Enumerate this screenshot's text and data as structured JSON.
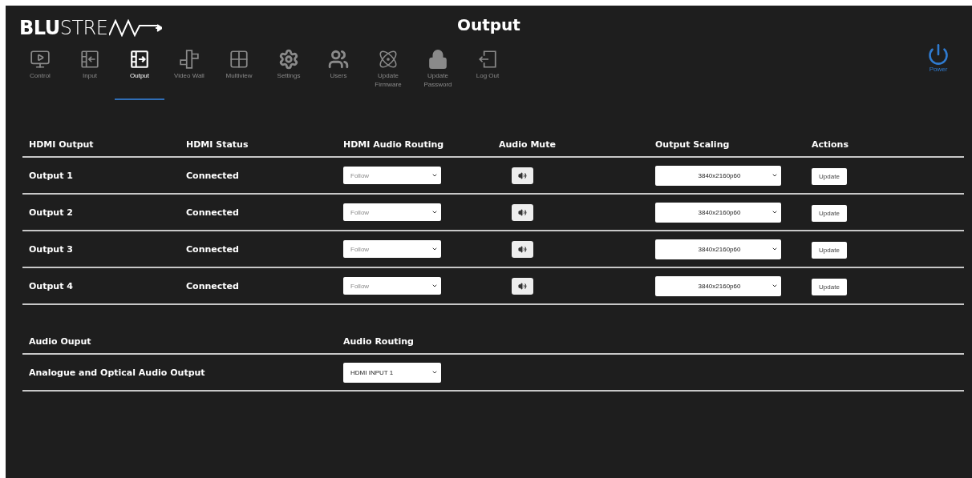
{
  "logo": {
    "text": "**BLU**STRE"
  },
  "page_title": "Output",
  "nav": [
    {
      "label": "Control",
      "kind": "control",
      "selected": false
    },
    {
      "label": "Input",
      "kind": "input",
      "selected": false
    },
    {
      "label": "Output",
      "kind": "output",
      "selected": true
    },
    {
      "label": "Video Wall",
      "kind": "videowall",
      "selected": false
    },
    {
      "label": "Multiview",
      "kind": "multiview",
      "selected": false
    },
    {
      "label": "Settings",
      "kind": "settings",
      "selected": false
    },
    {
      "label": "Users",
      "kind": "users",
      "selected": false
    },
    {
      "label": "Update Firmware",
      "kind": "firmware",
      "selected": false
    },
    {
      "label": "Update Password",
      "kind": "password",
      "selected": false
    },
    {
      "label": "Log Out",
      "kind": "logout",
      "selected": false
    }
  ],
  "power": {
    "label": "Power"
  },
  "outputs_table": {
    "columns": [
      "HDMI Output",
      "HDMI Status",
      "HDMI Audio Routing",
      "Audio Mute",
      "Output Scaling",
      "Actions"
    ],
    "rows": [
      {
        "output": "Output 1",
        "status": "Connected",
        "audio_routing": "Follow",
        "scaling": "3840x2160p60",
        "action": "Update"
      },
      {
        "output": "Output 2",
        "status": "Connected",
        "audio_routing": "Follow",
        "scaling": "3840x2160p60",
        "action": "Update"
      },
      {
        "output": "Output 3",
        "status": "Connected",
        "audio_routing": "Follow",
        "scaling": "3840x2160p60",
        "action": "Update"
      },
      {
        "output": "Output 4",
        "status": "Connected",
        "audio_routing": "Follow",
        "scaling": "3840x2160p60",
        "action": "Update"
      }
    ]
  },
  "audio_table": {
    "columns": [
      "Audio Ouput",
      "Audio Routing"
    ],
    "rows": [
      {
        "output": "Analogue and Optical Audio Output",
        "routing": "HDMI INPUT 1"
      }
    ]
  }
}
